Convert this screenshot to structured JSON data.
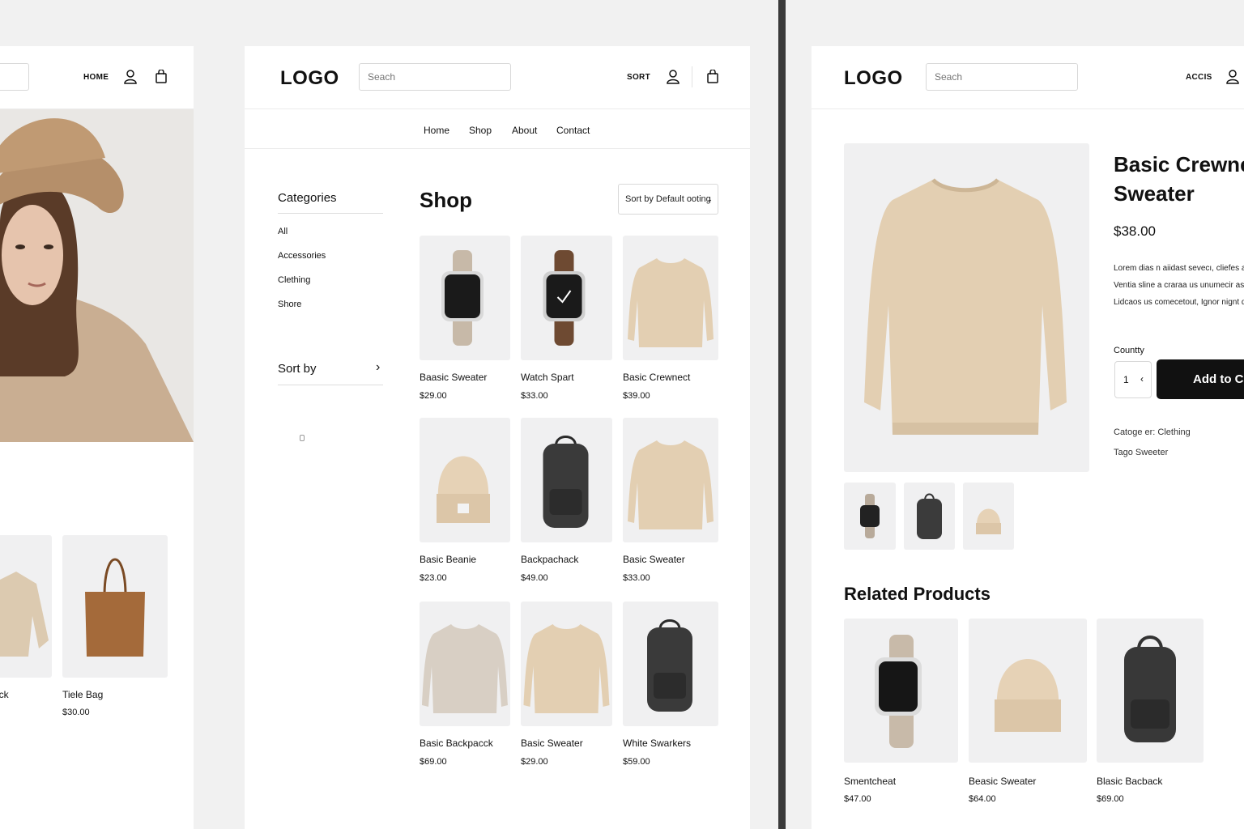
{
  "left": {
    "search_value": "",
    "nav_home": "HOME",
    "products": [
      {
        "name": "ack",
        "price": ""
      },
      {
        "name": "Tiele Bag",
        "price": "$30.00"
      }
    ]
  },
  "mid": {
    "logo": "LOGO",
    "search_placeholder": "Seach",
    "sort_label": "SORT",
    "nav": [
      "Home",
      "Shop",
      "About",
      "Contact"
    ],
    "categories_title": "Categories",
    "categories": [
      "All",
      "Accessories",
      "Clething",
      "Shore"
    ],
    "sortby_title": "Sort by",
    "sortby_chevron": "›",
    "shop_title": "Shop",
    "sort_select": "Sort by Default ooting",
    "products": [
      {
        "name": "Baasic Sweater",
        "price": "$29.00",
        "icon": "watch-beige"
      },
      {
        "name": "Watch Spart",
        "price": "$33.00",
        "icon": "watch-brown"
      },
      {
        "name": "Basic Crewnect",
        "price": "$39.00",
        "icon": "sweater"
      },
      {
        "name": "Basic Beanie",
        "price": "$23.00",
        "icon": "beanie"
      },
      {
        "name": "Backpachack",
        "price": "$49.00",
        "icon": "backpack"
      },
      {
        "name": "Basic Sweater",
        "price": "$33.00",
        "icon": "sweater"
      },
      {
        "name": "Basic Backpacck",
        "price": "$69.00",
        "icon": "sweater-grey"
      },
      {
        "name": "Basic Sweater",
        "price": "$29.00",
        "icon": "sweater"
      },
      {
        "name": "White Swarkers",
        "price": "$59.00",
        "icon": "backpack"
      }
    ]
  },
  "right": {
    "logo": "LOGO",
    "search_placeholder": "Seach",
    "account_label": "ACCIS",
    "title_line1": "Basic Crewneck",
    "title_line2": "Sweater",
    "price": "$38.00",
    "desc": [
      "Lorem dias n aiidast sevecı, cliefes ara",
      "Ventia sline a craraa us unumecir as, a",
      "Lidcaos us comecetout, Ignor nignt doc"
    ],
    "qty_label": "Countty",
    "qty_value": "1",
    "qty_chevron": "‹",
    "add_to_cart": "Add to Car",
    "category_meta": "Catoge er: Clething",
    "tag_meta": "Tago Sweeter",
    "related_title": "Related Products",
    "related": [
      {
        "name": "Smentcheat",
        "price": "$47.00"
      },
      {
        "name": "Beasic Sweater",
        "price": "$64.00"
      },
      {
        "name": "Blasic Bacback",
        "price": "$69.00"
      }
    ]
  }
}
